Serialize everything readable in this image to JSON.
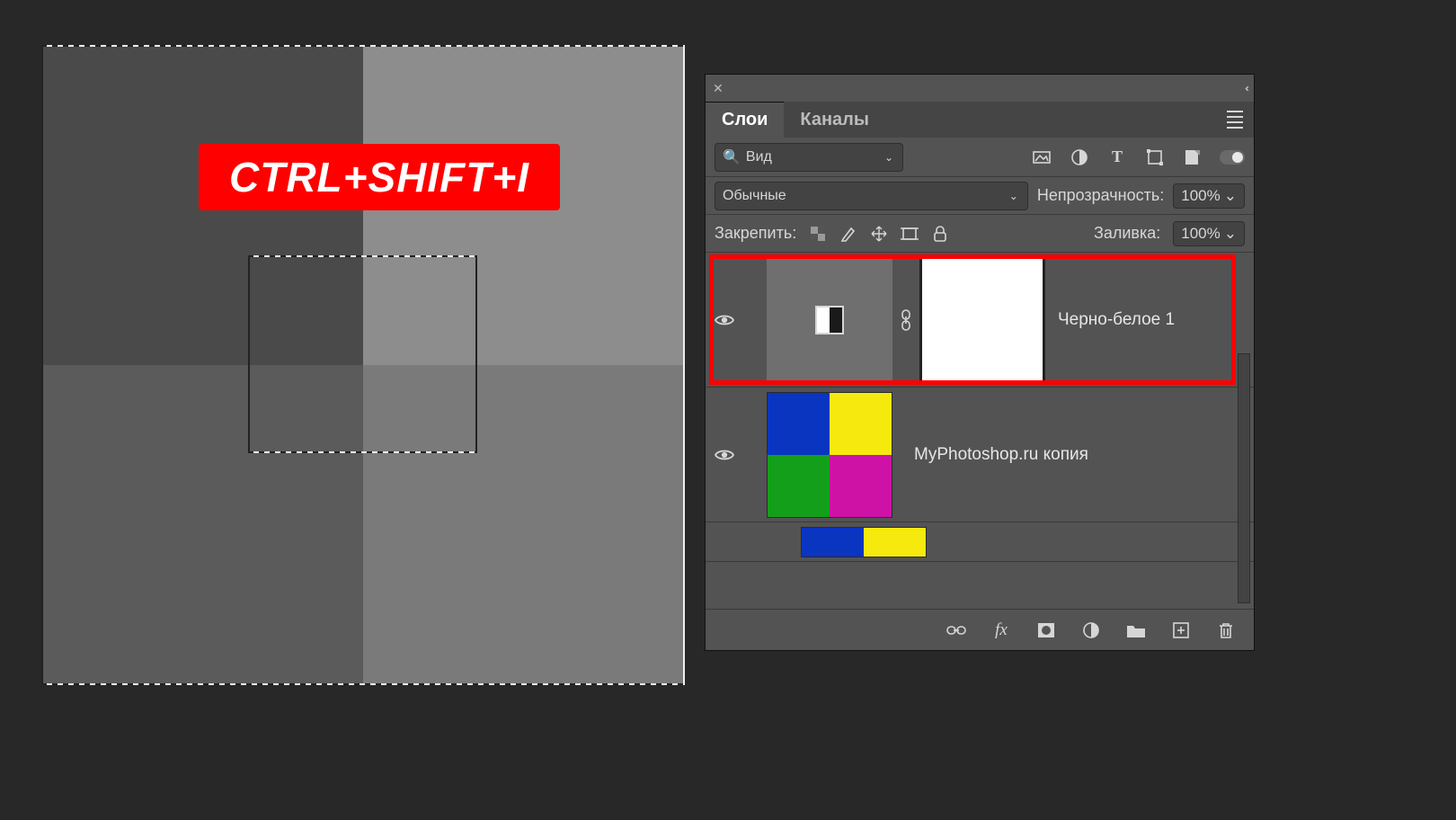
{
  "canvas": {
    "shortcut_label": "CTRL+SHIFT+I"
  },
  "panel": {
    "tabs": {
      "layers": "Слои",
      "channels": "Каналы"
    },
    "filter_dd": "Вид",
    "blend_mode": "Обычные",
    "opacity_label": "Непрозрачность:",
    "opacity_value": "100%",
    "lock_label": "Закрепить:",
    "fill_label": "Заливка:",
    "fill_value": "100%",
    "layers": [
      {
        "name": "Черно-белое 1"
      },
      {
        "name": "MyPhotoshop.ru копия"
      },
      {
        "name": ""
      }
    ]
  }
}
